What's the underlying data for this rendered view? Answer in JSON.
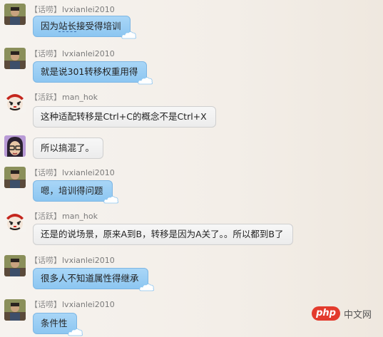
{
  "messages": [
    {
      "role": "【话唠】",
      "user": "lvxianlei2010",
      "text_a": "因为",
      "text_link": "站长",
      "text_b": "接受得培训",
      "style": "blue",
      "avatar": "user-photo"
    },
    {
      "role": "【话唠】",
      "user": "lvxianlei2010",
      "text": "就是说301转移权重用得",
      "style": "blue",
      "avatar": "user-photo"
    },
    {
      "role": "【活跃】",
      "user": "man_hok",
      "text": "这种适配转移是Ctrl+C的概念不是Ctrl+X",
      "style": "gray",
      "avatar": "opera-mask"
    },
    {
      "role": "",
      "user": "",
      "text": "所以搞混了。",
      "style": "gray",
      "avatar": "glasses-face"
    },
    {
      "role": "【话唠】",
      "user": "lvxianlei2010",
      "text": "嗯，培训得问题",
      "style": "blue",
      "avatar": "user-photo"
    },
    {
      "role": "【活跃】",
      "user": "man_hok",
      "text": "还是的说场景，原来A到B，转移是因为A关了。。所以都到B了",
      "style": "gray",
      "avatar": "opera-mask"
    },
    {
      "role": "【话唠】",
      "user": "lvxianlei2010",
      "text": "很多人不知道属性得继承",
      "style": "blue",
      "avatar": "user-photo"
    },
    {
      "role": "【话唠】",
      "user": "lvxianlei2010",
      "text": "条件性",
      "style": "blue",
      "avatar": "user-photo"
    }
  ],
  "watermark": {
    "logo": "php",
    "text": "中文网"
  },
  "colors": {
    "blue_bubble": "#8cc6f1",
    "gray_bubble": "#ececec",
    "logo_red": "#e33b2d"
  }
}
